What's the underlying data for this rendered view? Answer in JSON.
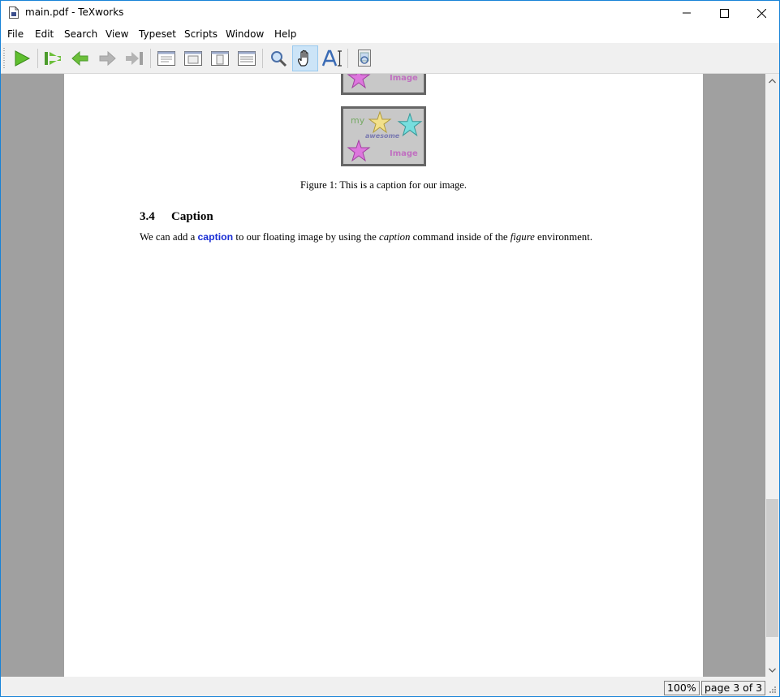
{
  "window": {
    "title": "main.pdf - TeXworks"
  },
  "menu": [
    "File",
    "Edit",
    "Search",
    "View",
    "Typeset",
    "Scripts",
    "Window",
    "Help"
  ],
  "toolbar": {
    "buttons": [
      {
        "name": "typeset-button",
        "icon": "play-icon"
      },
      {
        "name": "first-page-button",
        "icon": "first-page-icon"
      },
      {
        "name": "previous-page-button",
        "icon": "arrow-left-icon"
      },
      {
        "name": "next-page-button",
        "icon": "arrow-right-icon"
      },
      {
        "name": "last-page-button",
        "icon": "last-page-icon"
      },
      {
        "name": "actual-size-button",
        "icon": "page-actual-size-icon"
      },
      {
        "name": "fit-width-button",
        "icon": "page-fit-width-icon"
      },
      {
        "name": "fit-window-button",
        "icon": "page-fit-window-icon"
      },
      {
        "name": "continuous-scroll-button",
        "icon": "page-continuous-icon"
      },
      {
        "name": "magnify-tool-button",
        "icon": "magnifier-icon"
      },
      {
        "name": "scroll-tool-button",
        "icon": "hand-icon",
        "active": true
      },
      {
        "name": "select-text-tool-button",
        "icon": "text-select-icon"
      },
      {
        "name": "goto-source-button",
        "icon": "goto-source-icon"
      }
    ]
  },
  "document": {
    "figure_words": {
      "word1": "my",
      "word2": "awesome",
      "word3": "Image"
    },
    "caption": "Figure 1: This is a caption for our image.",
    "section": {
      "number": "3.4",
      "title": "Caption"
    },
    "paragraph": {
      "part1": "We can add a ",
      "link": "caption",
      "part2": " to our floating image by using the ",
      "em1": "caption",
      "part3": " command inside of the ",
      "em2": "figure",
      "part4": " environment."
    }
  },
  "status": {
    "zoom": "100%",
    "page": "page 3 of 3"
  },
  "colors": {
    "accent": "#1883d7",
    "link": "#1a2ed4",
    "page_bg": "#a0a0a0"
  }
}
